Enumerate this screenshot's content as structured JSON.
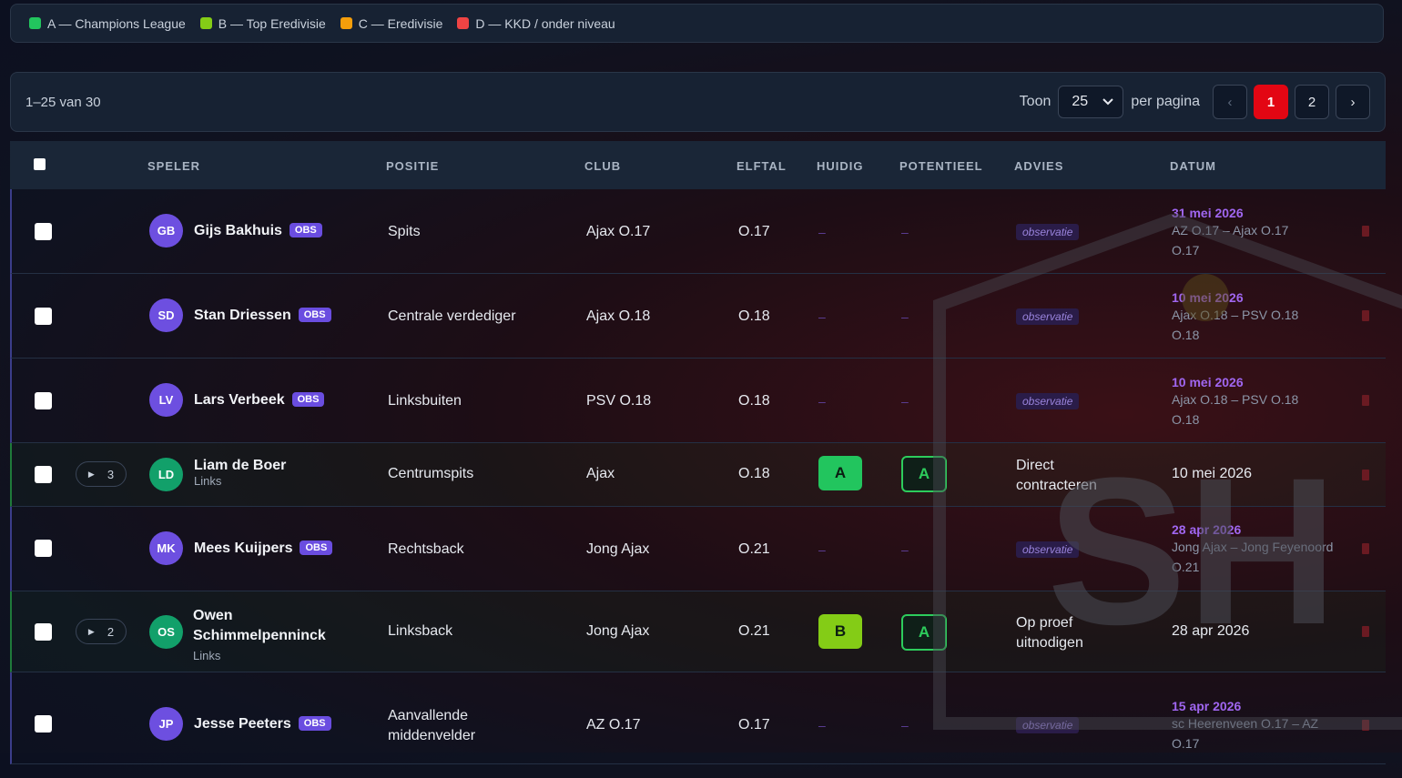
{
  "legend": [
    {
      "label": "A — Champions League",
      "color": "#22c55e"
    },
    {
      "label": "B — Top Eredivisie",
      "color": "#84cc16"
    },
    {
      "label": "C — Eredivisie",
      "color": "#f59e0b"
    },
    {
      "label": "D — KKD / onder niveau",
      "color": "#ef4444"
    }
  ],
  "toolbar": {
    "range": "1–25 van 30",
    "show_label": "Toon",
    "per_page": "25",
    "per_label": "per pagina",
    "prev": "‹",
    "pages": [
      "1",
      "2"
    ],
    "next": "›"
  },
  "table": {
    "headers": {
      "player": "SPELER",
      "position": "POSITIE",
      "club": "CLUB",
      "team": "ELFTAL",
      "current": "HUIDIG",
      "potential": "POTENTIEEL",
      "advice": "ADVIES",
      "date": "DATUM"
    },
    "rows": [
      {
        "initials": "GB",
        "name": "Gijs Bakhuis",
        "badge": "OBS",
        "position": "Spits",
        "club": "Ajax O.17",
        "team": "O.17",
        "current": "–",
        "potential": "–",
        "advice": "observatie",
        "date": "31 mei 2026",
        "match": "AZ O.17 – Ajax O.17",
        "match_team": "O.17"
      },
      {
        "initials": "SD",
        "name": "Stan Driessen",
        "badge": "OBS",
        "position": "Centrale verdediger",
        "club": "Ajax O.18",
        "team": "O.18",
        "current": "–",
        "potential": "–",
        "advice": "observatie",
        "date": "10 mei 2026",
        "match": "Ajax O.18 – PSV O.18",
        "match_team": "O.18"
      },
      {
        "initials": "LV",
        "name": "Lars Verbeek",
        "badge": "OBS",
        "position": "Linksbuiten",
        "club": "PSV O.18",
        "team": "O.18",
        "current": "–",
        "potential": "–",
        "advice": "observatie",
        "date": "10 mei 2026",
        "match": "Ajax O.18 – PSV O.18",
        "match_team": "O.18"
      },
      {
        "initials": "LD",
        "name": "Liam de Boer",
        "sub": "Links",
        "expand_count": "3",
        "position": "Centrumspits",
        "club": "Ajax",
        "team": "O.18",
        "current": "A",
        "potential": "A",
        "advice_line1": "Direct",
        "advice_line2": "contracteren",
        "date": "10 mei 2026"
      },
      {
        "initials": "MK",
        "name": "Mees Kuijpers",
        "badge": "OBS",
        "position": "Rechtsback",
        "club": "Jong Ajax",
        "team": "O.21",
        "current": "–",
        "potential": "–",
        "advice": "observatie",
        "date": "28 apr 2026",
        "match": "Jong Ajax – Jong Feyenoord",
        "match_team": "O.21"
      },
      {
        "initials": "OS",
        "name_line1": "Owen",
        "name_line2": "Schimmelpenninck",
        "sub": "Links",
        "expand_count": "2",
        "position": "Linksback",
        "club": "Jong Ajax",
        "team": "O.21",
        "current": "B",
        "potential": "A",
        "advice_line1": "Op proef",
        "advice_line2": "uitnodigen",
        "date": "28 apr 2026"
      },
      {
        "initials": "JP",
        "name": "Jesse Peeters",
        "badge": "OBS",
        "position_line1": "Aanvallende",
        "position_line2": "middenvelder",
        "club": "AZ O.17",
        "team": "O.17",
        "current": "–",
        "potential": "–",
        "advice": "observatie",
        "date": "15 apr 2026",
        "match": "sc Heerenveen O.17 – AZ",
        "match_team": "O.17"
      }
    ]
  },
  "colors": {
    "accent": "#e30613",
    "grade_a": "#22c55e",
    "grade_b": "#84cc16",
    "obs_badge": "#6a4de0"
  },
  "watermark": {
    "text": "SH"
  }
}
